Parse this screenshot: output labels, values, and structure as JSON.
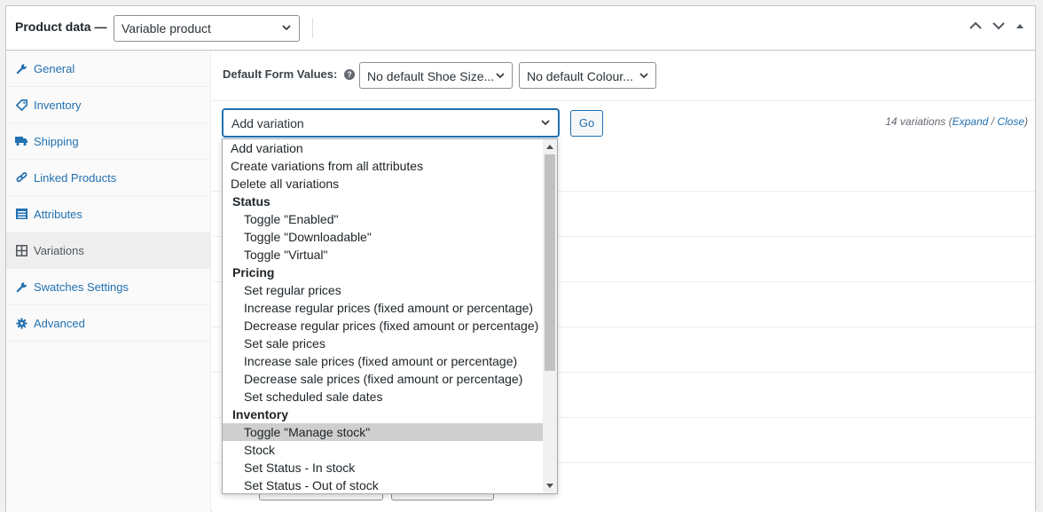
{
  "header": {
    "title": "Product data —",
    "product_type": "Variable product"
  },
  "tabs": [
    {
      "label": "General",
      "icon": "wrench-icon"
    },
    {
      "label": "Inventory",
      "icon": "tag-icon"
    },
    {
      "label": "Shipping",
      "icon": "truck-icon"
    },
    {
      "label": "Linked Products",
      "icon": "link-icon"
    },
    {
      "label": "Attributes",
      "icon": "list-icon"
    },
    {
      "label": "Variations",
      "icon": "grid-icon"
    },
    {
      "label": "Swatches Settings",
      "icon": "wrench-icon"
    },
    {
      "label": "Advanced",
      "icon": "gear-icon"
    }
  ],
  "default_form": {
    "label": "Default Form Values:",
    "help": "?",
    "shoe_size": "No default Shoe Size...",
    "colour": "No default Colour..."
  },
  "bulk": {
    "selected": "Add variation",
    "go_label": "Go",
    "count_text": "14 variations (",
    "expand_label": "Expand",
    "slash": " / ",
    "close_label": "Close",
    "close_paren": ")"
  },
  "dropdown": {
    "options": [
      "Add variation",
      "Create variations from all attributes",
      "Delete all variations"
    ],
    "status_group": "Status",
    "status_items": [
      "Toggle \"Enabled\"",
      "Toggle \"Downloadable\"",
      "Toggle \"Virtual\""
    ],
    "pricing_group": "Pricing",
    "pricing_items": [
      "Set regular prices",
      "Increase regular prices (fixed amount or percentage)",
      "Decrease regular prices (fixed amount or percentage)",
      "Set sale prices",
      "Increase sale prices (fixed amount or percentage)",
      "Decrease sale prices (fixed amount or percentage)",
      "Set scheduled sale dates"
    ],
    "inventory_group": "Inventory",
    "inventory_items": [
      "Toggle \"Manage stock\"",
      "Stock",
      "Set Status - In stock",
      "Set Status - Out of stock"
    ],
    "highlighted": "Toggle \"Manage stock\""
  },
  "colors": {
    "link": "#2271b1",
    "border": "#c3c4c7",
    "highlight": "#cfcfcf"
  }
}
